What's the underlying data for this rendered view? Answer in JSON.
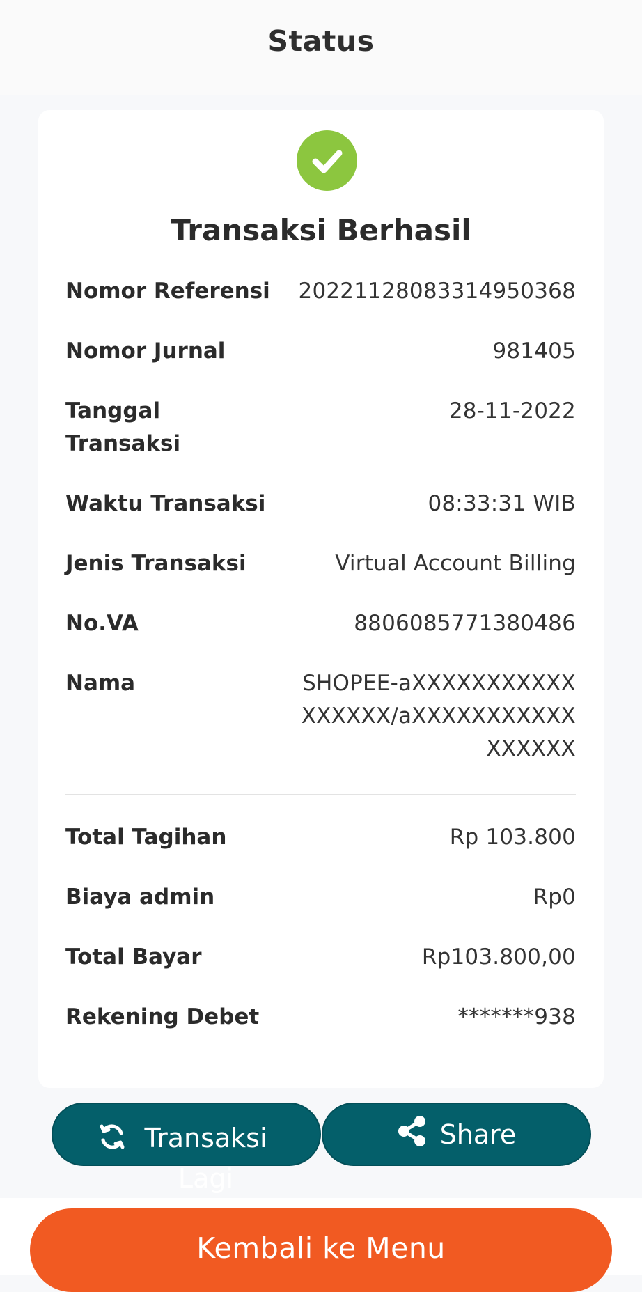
{
  "header": {
    "title": "Status"
  },
  "status": {
    "title": "Transaksi Berhasil",
    "icon": "check-circle-icon",
    "color": "#8cc63f"
  },
  "details": [
    {
      "label": "Nomor Referensi",
      "value": "20221128083314950368"
    },
    {
      "label": "Nomor Jurnal",
      "value": "981405"
    },
    {
      "label": "Tanggal Transaksi",
      "value": "28-11-2022"
    },
    {
      "label": "Waktu Transaksi",
      "value": "08:33:31 WIB"
    },
    {
      "label": "Jenis Transaksi",
      "value": "Virtual Account Billing"
    },
    {
      "label": "No.VA",
      "value": "8806085771380486"
    },
    {
      "label": "Nama",
      "value": "SHOPEE-aXXXXXXXXXXXXXXXXX/aXXXXXXXXXXXXXXXXX"
    }
  ],
  "totals": [
    {
      "label": "Total Tagihan",
      "value": "Rp 103.800"
    },
    {
      "label": "Biaya admin",
      "value": "Rp0"
    },
    {
      "label": "Total Bayar",
      "value": "Rp103.800,00"
    },
    {
      "label": "Rekening Debet",
      "value": "*******938"
    }
  ],
  "actions": {
    "again_label": "Transaksi Lagi",
    "again_icon": "refresh-icon",
    "share_label": "Share",
    "share_icon": "share-icon",
    "menu_label": "Kembali ke Menu"
  },
  "colors": {
    "teal": "#045f6a",
    "orange": "#f15a22"
  }
}
